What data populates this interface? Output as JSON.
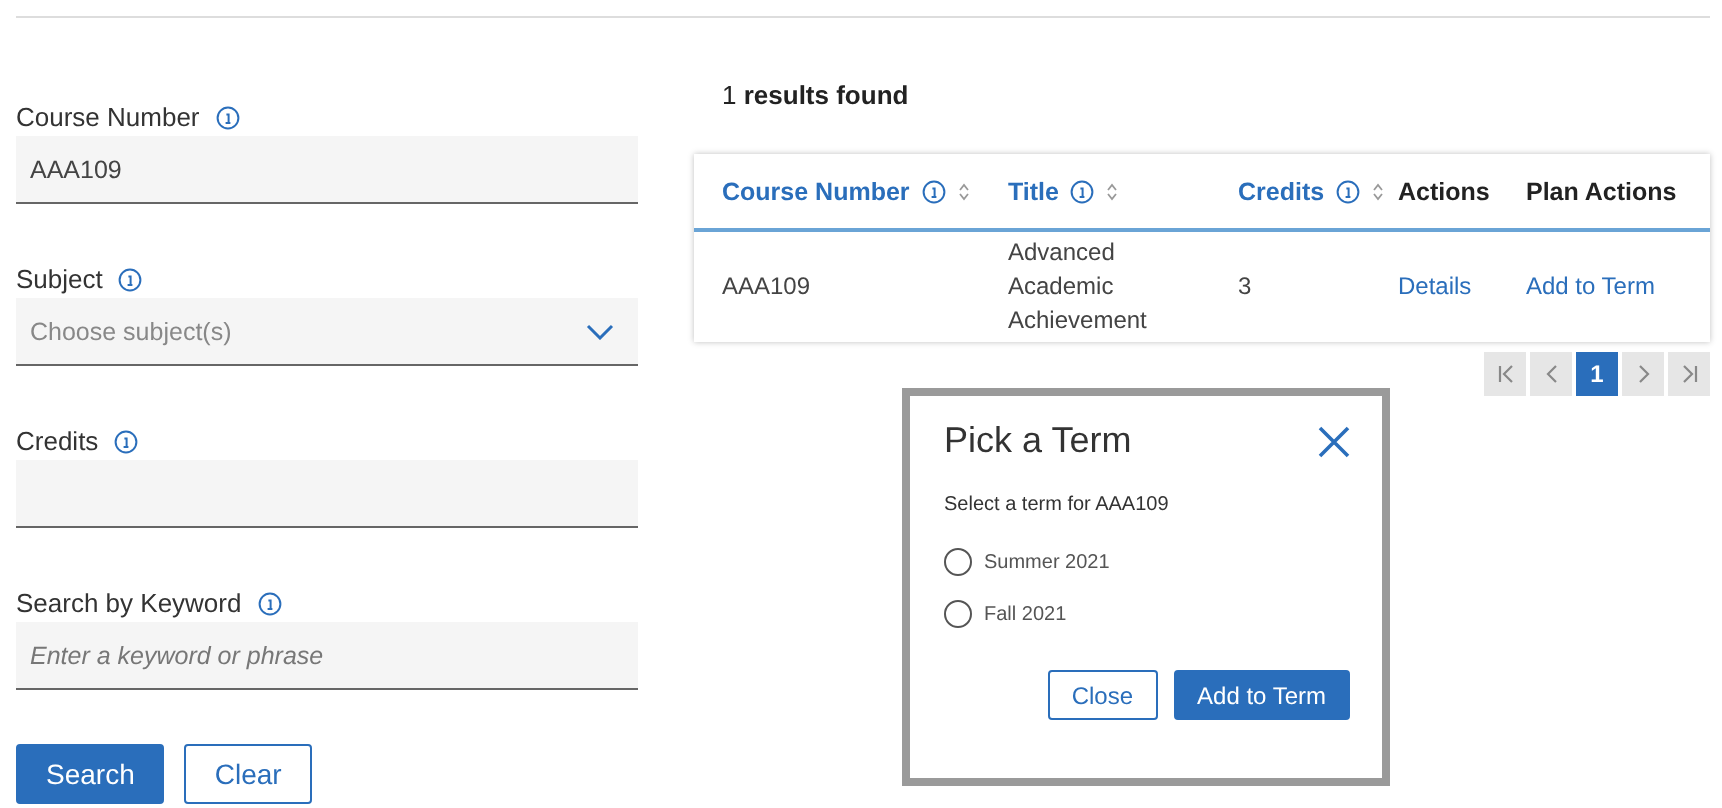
{
  "search_form": {
    "fields": [
      {
        "kind": "text",
        "label": "Course Number",
        "value": "AAA109"
      },
      {
        "kind": "select",
        "label": "Subject",
        "placeholder": "Choose subject(s)"
      },
      {
        "kind": "text",
        "label": "Credits"
      },
      {
        "kind": "text",
        "label": "Search by Keyword",
        "placeholder": "Enter a keyword or phrase"
      }
    ],
    "buttons": [
      {
        "kind": "primary",
        "label": "Search"
      },
      {
        "kind": "secondary",
        "label": "Clear"
      }
    ]
  },
  "results": {
    "count": "1",
    "summary": "results found",
    "columns": [
      {
        "label": "Course Number",
        "sortable": true
      },
      {
        "label": "Title",
        "sortable": true
      },
      {
        "label": "Credits",
        "sortable": true
      },
      {
        "label": "Actions",
        "sortable": false
      },
      {
        "label": "Plan Actions",
        "sortable": false
      }
    ],
    "rows": [
      {
        "course_number": "AAA109",
        "title": "Advanced Academic Achievement",
        "credits": "3",
        "details": "Details",
        "plan_action": "Add to Term"
      }
    ],
    "pagination": {
      "pages": [
        {
          "label": "1",
          "selected": true
        }
      ]
    }
  },
  "dialog": {
    "title": "Pick a Term",
    "prompt": "Select a term for AAA109",
    "options": [
      {
        "label": "Summer 2021",
        "selected": false
      },
      {
        "label": "Fall 2021",
        "selected": false
      }
    ],
    "buttons": [
      {
        "kind": "secondary",
        "label": "Close"
      },
      {
        "kind": "primary",
        "label": "Add to Term"
      }
    ]
  }
}
